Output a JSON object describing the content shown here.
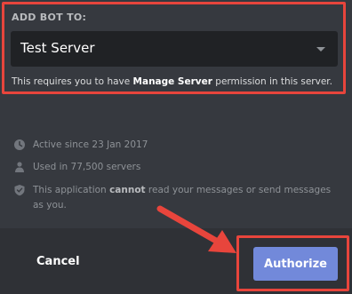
{
  "add_bot": {
    "label": "ADD BOT TO:",
    "selected_server": "Test Server",
    "permission_note": {
      "prefix": "This requires you to have ",
      "bold": "Manage Server",
      "suffix": " permission in this server."
    }
  },
  "info": {
    "active_since": "Active since 23 Jan 2017",
    "used_in": "Used in 77,500 servers",
    "privacy": {
      "prefix": "This application ",
      "bold": "cannot",
      "suffix": " read your messages or send messages as you."
    }
  },
  "footer": {
    "cancel_label": "Cancel",
    "authorize_label": "Authorize"
  },
  "colors": {
    "background": "#36393f",
    "footer": "#2f3136",
    "select_background": "#202225",
    "accent": "#7289da",
    "annotation_red": "#e8453c"
  },
  "icons": {
    "active": "clock-icon",
    "servers": "users-icon",
    "privacy": "shield-icon",
    "select": "caret-down-icon",
    "annotation": "arrow-annotation"
  }
}
